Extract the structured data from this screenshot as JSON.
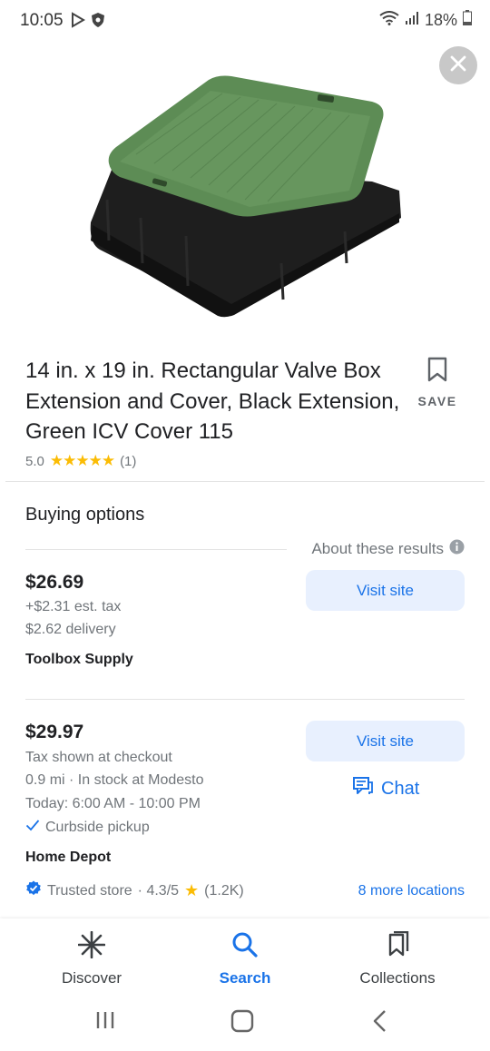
{
  "status": {
    "time": "10:05",
    "battery": "18%",
    "icons": [
      "play-icon",
      "shield-icon",
      "wifi-icon",
      "signal-icon",
      "battery-icon"
    ]
  },
  "product": {
    "title": "14 in. x 19 in. Rectangular Valve Box Extension and Cover, Black Extension, Green ICV Cover 115",
    "save_label": "SAVE",
    "rating_value": "5.0",
    "stars": "★★★★★",
    "rating_count": "(1)",
    "star_fraction": 1.0
  },
  "buying": {
    "heading": "Buying options",
    "about": "About these results",
    "offers": [
      {
        "price": "$26.69",
        "line1": "+$2.31 est. tax",
        "line2": "$2.62 delivery",
        "store": "Toolbox Supply",
        "visit_label": "Visit site"
      },
      {
        "price": "$29.97",
        "line1": "Tax shown at checkout",
        "line2": "0.9 mi · In stock at Modesto",
        "line3": "Today: 6:00 AM - 10:00 PM",
        "curbside": "Curbside pickup",
        "store": "Home Depot",
        "visit_label": "Visit site",
        "chat_label": "Chat",
        "trusted": "Trusted store",
        "store_rating": "· 4.3/5",
        "store_rating_count": "(1.2K)",
        "more_locations": "8 more locations"
      }
    ]
  },
  "nav": {
    "items": [
      {
        "label": "Discover",
        "icon": "asterisk-icon"
      },
      {
        "label": "Search",
        "icon": "search-icon",
        "active": true
      },
      {
        "label": "Collections",
        "icon": "collections-icon"
      }
    ]
  },
  "colors": {
    "accent": "#1a73e8",
    "star": "#fbbc04",
    "button_bg": "#e8f0fe",
    "cover_green": "#5d8c55"
  }
}
